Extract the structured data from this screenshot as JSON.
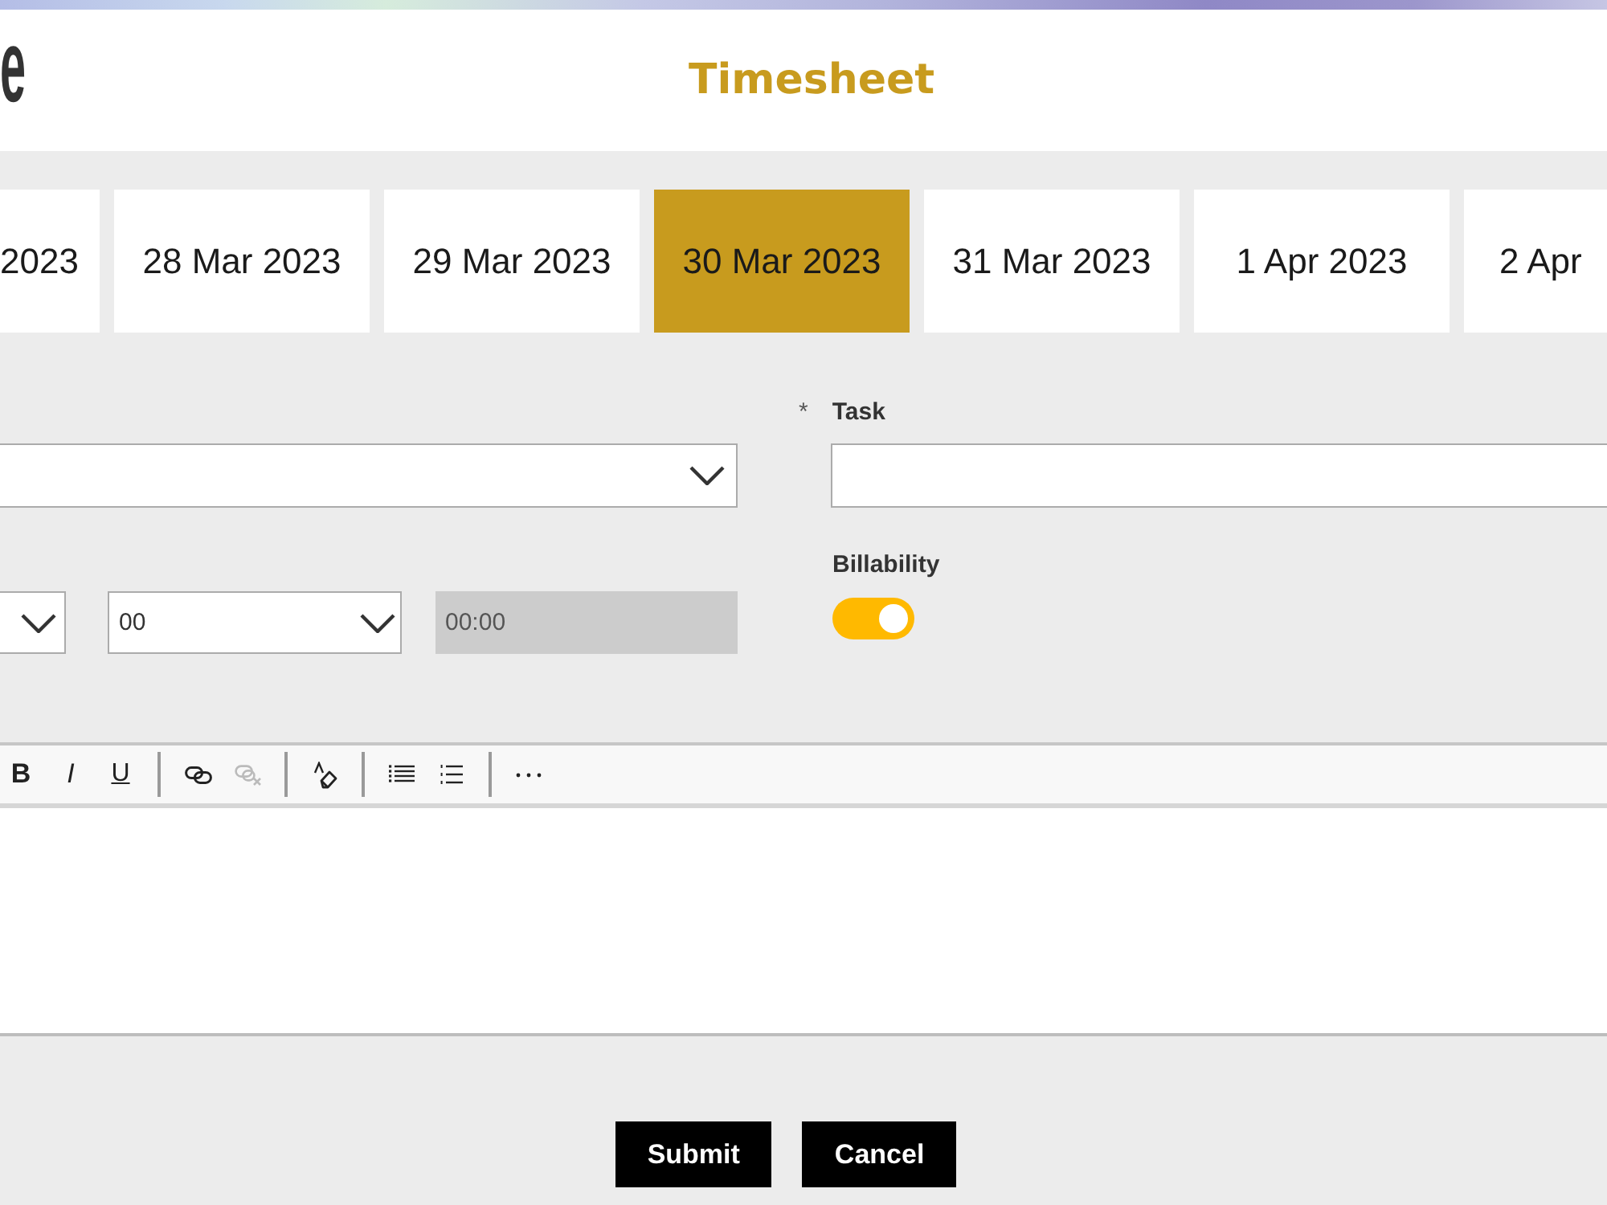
{
  "header": {
    "logo_text": "e",
    "title": "Timesheet"
  },
  "date_tabs": [
    {
      "label": "2023",
      "selected": false
    },
    {
      "label": "28 Mar 2023",
      "selected": false
    },
    {
      "label": "29 Mar 2023",
      "selected": false
    },
    {
      "label": "30 Mar 2023",
      "selected": true
    },
    {
      "label": "31 Mar 2023",
      "selected": false
    },
    {
      "label": "1 Apr 2023",
      "selected": false
    },
    {
      "label": "2 Apr",
      "selected": false
    }
  ],
  "form": {
    "task": {
      "required_mark": "*",
      "label": "Task"
    },
    "minutes": {
      "value": "00"
    },
    "duration": {
      "value": "00:00",
      "disabled": true
    },
    "billability": {
      "label": "Billability",
      "on": true
    }
  },
  "editor": {
    "toolbar_groups": [
      {
        "tools": [
          {
            "kind": "bold",
            "label": "B",
            "disabled": false
          },
          {
            "kind": "italic",
            "label": "I",
            "disabled": false
          },
          {
            "kind": "underline",
            "label": "U",
            "disabled": false
          }
        ]
      },
      {
        "tools": [
          {
            "kind": "link",
            "disabled": false
          },
          {
            "kind": "unlink",
            "disabled": true
          }
        ]
      },
      {
        "tools": [
          {
            "kind": "clear_format",
            "disabled": false
          }
        ]
      },
      {
        "tools": [
          {
            "kind": "bullets",
            "disabled": false
          },
          {
            "kind": "numbering",
            "disabled": false
          }
        ]
      },
      {
        "tools": [
          {
            "kind": "more",
            "disabled": false
          }
        ]
      }
    ]
  },
  "buttons": [
    {
      "label": "Submit"
    },
    {
      "label": "Cancel"
    }
  ]
}
